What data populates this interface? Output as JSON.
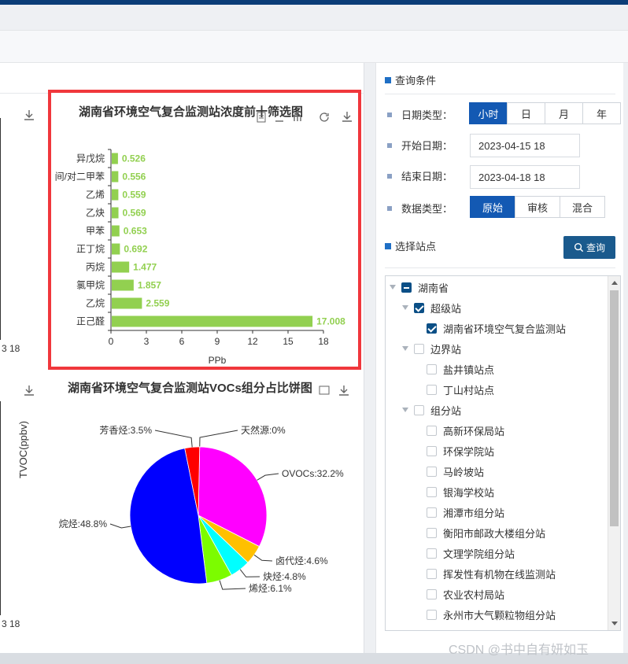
{
  "bar_chart": {
    "title": "湖南省环境空气复合监测站浓度前十筛选图",
    "xlabel": "PPb",
    "bar_color": "#92d050",
    "highlight_color": "#f0373c"
  },
  "chart_data": [
    {
      "type": "bar",
      "orientation": "horizontal",
      "title": "湖南省环境空气复合监测站浓度前十筛选图",
      "xlabel": "PPb",
      "ylabel": "",
      "categories": [
        "异戊烷",
        "间/对二甲苯",
        "乙烯",
        "乙炔",
        "甲苯",
        "正丁烷",
        "丙烷",
        "氯甲烷",
        "乙烷",
        "正己醛"
      ],
      "values": [
        0.526,
        0.556,
        0.559,
        0.569,
        0.653,
        0.692,
        1.477,
        1.857,
        2.559,
        17.008
      ],
      "value_labels": [
        "0.526",
        "0.556",
        "0.559",
        "0.569",
        "0.653",
        "0.692",
        "1.477",
        "1.857",
        "2.559",
        "17.008"
      ],
      "xlim": [
        0,
        18
      ],
      "xticks": [
        "0",
        "3",
        "6",
        "9",
        "12",
        "15",
        "18"
      ],
      "color": "#92d050",
      "grid": false,
      "legend": "none"
    },
    {
      "type": "pie",
      "title": "湖南省环境空气复合监测站VOCs组分占比饼图",
      "slices": [
        {
          "name": "天然源",
          "value": 0.0,
          "label": "天然源:0%",
          "color": "#2e7d32"
        },
        {
          "name": "OVOCs",
          "value": 32.2,
          "label": "OVOCs:32.2%",
          "color": "#ff00ff"
        },
        {
          "name": "卤代烃",
          "value": 4.6,
          "label": "卤代烃:4.6%",
          "color": "#ffc000"
        },
        {
          "name": "炔烃",
          "value": 4.8,
          "label": "炔烃:4.8%",
          "color": "#00ffff"
        },
        {
          "name": "烯烃",
          "value": 6.1,
          "label": "烯烃:6.1%",
          "color": "#7cfc00"
        },
        {
          "name": "烷烃",
          "value": 48.8,
          "label": "烷烃:48.8%",
          "color": "#0000ff"
        },
        {
          "name": "芳香烃",
          "value": 3.5,
          "label": "芳香烃:3.5%",
          "color": "#ff0000"
        }
      ],
      "legend": "none"
    }
  ],
  "left_stub": {
    "tick_top": "3 18",
    "tick_bottom": "3 18",
    "ylabel": "TVOC(ppbv)"
  },
  "query": {
    "section_title": "查询条件",
    "date_type_label": "日期类型：",
    "date_types": [
      "小时",
      "日",
      "月",
      "年"
    ],
    "date_type_selected": "小时",
    "start_label": "开始日期：",
    "start_value": "2023-04-15 18",
    "end_label": "结束日期：",
    "end_value": "2023-04-18 18",
    "data_type_label": "数据类型：",
    "data_types": [
      "原始",
      "审核",
      "混合"
    ],
    "data_type_selected": "原始",
    "station_section_title": "选择站点",
    "query_button": "查询"
  },
  "tree": [
    {
      "label": "湖南省",
      "level": 0,
      "state": "partial",
      "expand": true
    },
    {
      "label": "超级站",
      "level": 1,
      "state": "checked",
      "expand": true
    },
    {
      "label": "湖南省环境空气复合监测站",
      "level": 2,
      "state": "checked",
      "expand": false
    },
    {
      "label": "边界站",
      "level": 1,
      "state": "none",
      "expand": true
    },
    {
      "label": "盐井镇站点",
      "level": 2,
      "state": "none",
      "expand": false
    },
    {
      "label": "丁山村站点",
      "level": 2,
      "state": "none",
      "expand": false
    },
    {
      "label": "组分站",
      "level": 1,
      "state": "none",
      "expand": true
    },
    {
      "label": "高新环保局站",
      "level": 2,
      "state": "none",
      "expand": false
    },
    {
      "label": "环保学院站",
      "level": 2,
      "state": "none",
      "expand": false
    },
    {
      "label": "马岭坡站",
      "level": 2,
      "state": "none",
      "expand": false
    },
    {
      "label": "银海学校站",
      "level": 2,
      "state": "none",
      "expand": false
    },
    {
      "label": "湘潭市组分站",
      "level": 2,
      "state": "none",
      "expand": false
    },
    {
      "label": "衡阳市邮政大楼组分站",
      "level": 2,
      "state": "none",
      "expand": false
    },
    {
      "label": "文理学院组分站",
      "level": 2,
      "state": "none",
      "expand": false
    },
    {
      "label": "挥发性有机物在线监测站",
      "level": 2,
      "state": "none",
      "expand": false
    },
    {
      "label": "农业农村局站",
      "level": 2,
      "state": "none",
      "expand": false
    },
    {
      "label": "永州市大气颗粒物组分站",
      "level": 2,
      "state": "none",
      "expand": false
    }
  ],
  "watermark": "CSDN @书中自有妍如玉"
}
